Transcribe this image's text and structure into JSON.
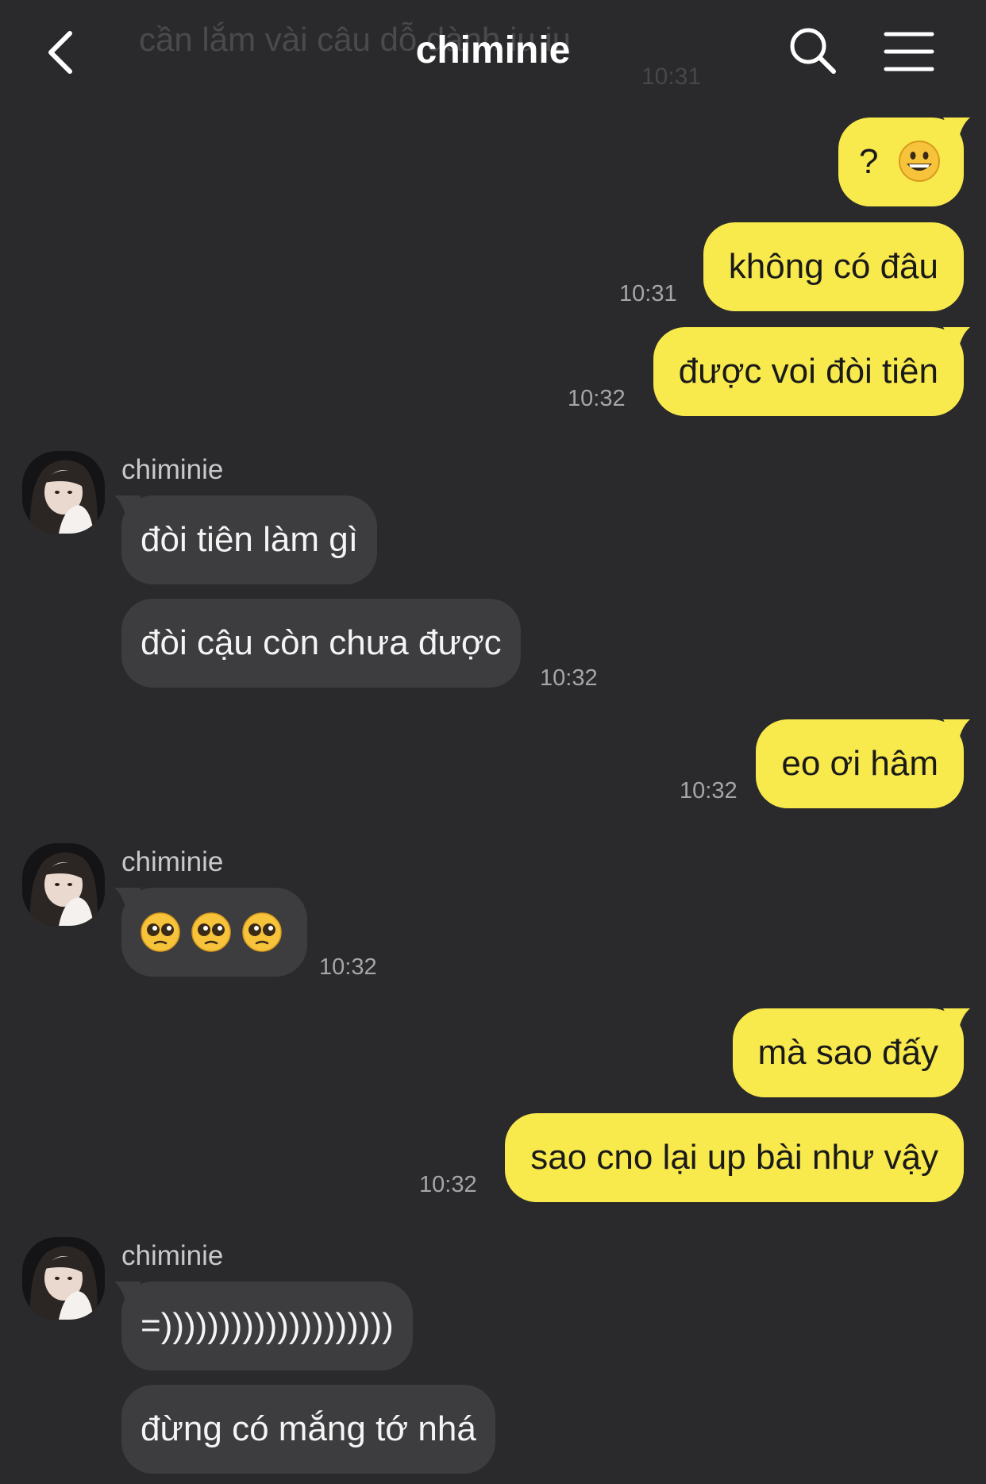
{
  "header": {
    "title": "chiminie",
    "ghost_message": "cần lắm vài câu dỗ dành iu iu",
    "ghost_time": "10:31"
  },
  "messages": [
    {
      "side": "me",
      "text": "?",
      "emoji": "grinning-face"
    },
    {
      "side": "me",
      "text": "không có đâu",
      "time": "10:31"
    },
    {
      "side": "me",
      "text": "được voi đòi tiên",
      "time": "10:32"
    },
    {
      "side": "them",
      "sender": "chiminie",
      "text": "đòi tiên làm gì"
    },
    {
      "side": "them",
      "text": "đòi cậu còn chưa được",
      "time": "10:32"
    },
    {
      "side": "me",
      "text": "eo ơi hâm",
      "time": "10:32"
    },
    {
      "side": "them",
      "sender": "chiminie",
      "emoji": "pleading-face x3",
      "time": "10:32"
    },
    {
      "side": "me",
      "text": "mà sao đấy"
    },
    {
      "side": "me",
      "text": "sao cno lại up bài như vậy",
      "time": "10:32"
    },
    {
      "side": "them",
      "sender": "chiminie",
      "text": "=))))))))))))))))))))"
    },
    {
      "side": "them",
      "text": "đừng có mắng tớ nhá"
    }
  ],
  "colors": {
    "background": "#2a2a2c",
    "my_bubble": "#f8e94c",
    "their_bubble": "#3d3d40"
  }
}
